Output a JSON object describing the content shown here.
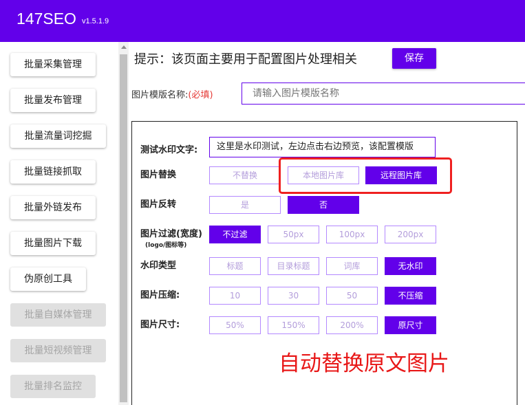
{
  "app": {
    "title": "147SEO",
    "version": "v1.5.1.9",
    "accent_color": "#6200ea"
  },
  "sidebar": {
    "items": [
      {
        "label": "批量采集管理",
        "disabled": false
      },
      {
        "label": "批量发布管理",
        "disabled": false
      },
      {
        "label": "批量流量词挖掘",
        "disabled": false
      },
      {
        "label": "批量链接抓取",
        "disabled": false
      },
      {
        "label": "批量外链发布",
        "disabled": false
      },
      {
        "label": "批量图片下载",
        "disabled": false
      },
      {
        "label": "伪原创工具",
        "disabled": false
      },
      {
        "label": "批量自媒体管理",
        "disabled": true
      },
      {
        "label": "批量短视频管理",
        "disabled": true
      },
      {
        "label": "批量排名监控",
        "disabled": true
      }
    ]
  },
  "main": {
    "hint": "提示：该页面主要用于配置图片处理相关",
    "save_label": "保存",
    "template_name": {
      "label": "图片模版名称:",
      "required": "(必填)",
      "placeholder": "请输入图片模版名称",
      "value": ""
    }
  },
  "settings": {
    "watermark_text": {
      "label": "测试水印文字:",
      "value": "这里是水印测试，左边点击右边预览，该配置模版"
    },
    "replace": {
      "label": "图片替换",
      "options": [
        "不替换",
        "本地图片库",
        "远程图片库"
      ],
      "selected": "远程图片库"
    },
    "flip": {
      "label": "图片反转",
      "options": [
        "是",
        "否"
      ],
      "selected": "否"
    },
    "filter": {
      "label": "图片过滤(宽度)",
      "sublabel": "(logo/图标等)",
      "options": [
        "不过滤",
        "50px",
        "100px",
        "200px"
      ],
      "selected": "不过滤"
    },
    "watermark_type": {
      "label": "水印类型",
      "options": [
        "标题",
        "目录标题",
        "词库",
        "无水印"
      ],
      "selected": "无水印"
    },
    "compress": {
      "label": "图片压缩:",
      "options": [
        "10",
        "30",
        "50",
        "不压缩"
      ],
      "selected": "不压缩"
    },
    "size": {
      "label": "图片尺寸:",
      "options": [
        "50%",
        "150%",
        "200%",
        "原尺寸"
      ],
      "selected": "原尺寸"
    }
  },
  "annotation": {
    "text": "自动替换原文图片",
    "color": "#e81818"
  }
}
